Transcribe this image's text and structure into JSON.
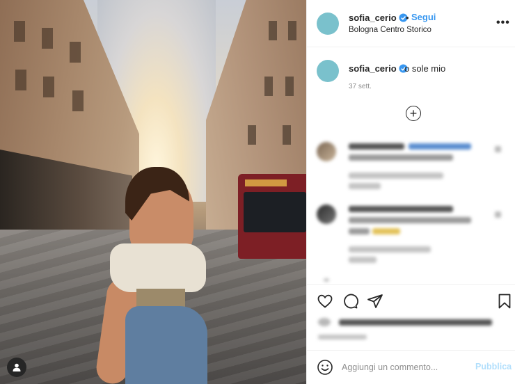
{
  "post": {
    "username": "sofia_cerio",
    "separator": "•",
    "follow_label": "Segui",
    "location": "Bologna Centro Storico",
    "more_label": "•••",
    "caption_text": "o sole mio",
    "caption_time": "37 sett.",
    "load_more_label": "+",
    "accent_color": "#3897f0",
    "avatar_color": "#7ac1cc"
  },
  "icons": [
    "verified-badge-icon",
    "more-options-icon",
    "plus-circle-icon",
    "heart-icon",
    "comment-icon",
    "share-icon",
    "bookmark-icon",
    "emoji-icon",
    "user-tag-icon"
  ],
  "comment_box": {
    "placeholder": "Aggiungi un commento...",
    "publish_label": "Pubblica"
  }
}
